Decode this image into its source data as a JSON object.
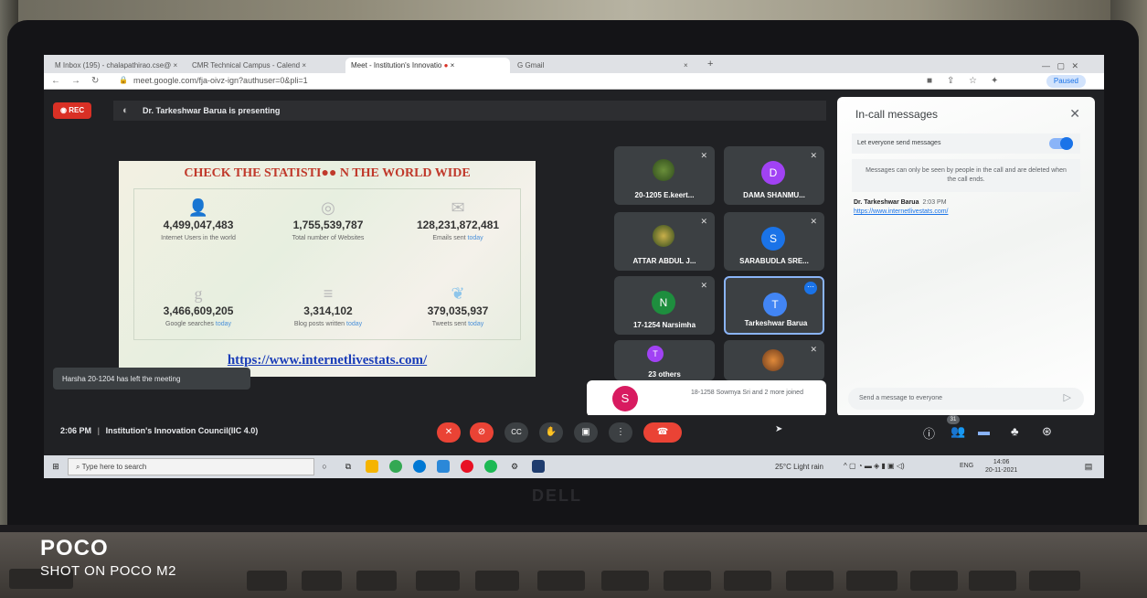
{
  "browser": {
    "tabs": [
      {
        "label": "M  Inbox (195) - chalapathirao.cse@",
        "close": "×"
      },
      {
        "label": "CMR Technical Campus - Calend",
        "close": "×"
      },
      {
        "label": "Meet - Institution's Innovatio",
        "close": "×"
      },
      {
        "label": "G  Gmail",
        "close": "×"
      }
    ],
    "new_tab": "+",
    "url": "meet.google.com/fja-oivz-ign?authuser=0&pli=1",
    "profile_label": "Paused"
  },
  "meet": {
    "rec_label": "REC",
    "presenting_text": "Dr. Tarkeshwar Barua is presenting",
    "slide": {
      "title": "CHECK THE STATISTI●● N THE WORLD WIDE",
      "stats": [
        {
          "icon": "user-icon",
          "glyph": "👤",
          "value": "4,499,047,483",
          "label": "Internet Users in the world",
          "highlight": ""
        },
        {
          "icon": "globe-icon",
          "glyph": "◎",
          "value": "1,755,539,787",
          "label": "Total number of Websites",
          "highlight": ""
        },
        {
          "icon": "mail-icon",
          "glyph": "✉",
          "value": "128,231,872,481",
          "label": "Emails sent",
          "highlight": "today"
        },
        {
          "icon": "google-icon",
          "glyph": "g",
          "value": "3,466,609,205",
          "label": "Google searches",
          "highlight": "today"
        },
        {
          "icon": "rss-icon",
          "glyph": "≡",
          "value": "3,314,102",
          "label": "Blog posts written",
          "highlight": "today"
        },
        {
          "icon": "twitter-icon",
          "glyph": "❦",
          "value": "379,035,937",
          "label": "Tweets sent",
          "highlight": "today"
        }
      ],
      "link": "https://www.internetlivestats.com/"
    },
    "participants": [
      {
        "name": "20-1205 E.keert...",
        "avatar": "",
        "color": ""
      },
      {
        "name": "DAMA SHANMU...",
        "avatar": "D",
        "color": "#a142f4"
      },
      {
        "name": "ATTAR ABDUL J...",
        "avatar": "",
        "color": ""
      },
      {
        "name": "SARABUDLA SRE...",
        "avatar": "S",
        "color": "#1a73e8"
      },
      {
        "name": "17-1254 Narsimha",
        "avatar": "N",
        "color": "#1e8e3e"
      },
      {
        "name": "Tarkeshwar Barua",
        "avatar": "T",
        "color": "#4285f4"
      },
      {
        "name": "23 others",
        "avatar": "T",
        "color": "#a142f4"
      },
      {
        "name": "",
        "avatar": "",
        "color": ""
      }
    ],
    "chat": {
      "title": "In-call messages",
      "toggle_label": "Let everyone send messages",
      "notice": "Messages can only be seen by people in the call and are deleted when the call ends.",
      "author": "Dr. Tarkeshwar Barua",
      "time": "2:03 PM",
      "message": "https://www.internetlivestats.com/",
      "input_placeholder": "Send a message to everyone"
    },
    "toast_left": "Harsha 20-1204 has left the meeting",
    "toast_join": {
      "avatar": "S",
      "text": "18-1258 Sowmya Sri and 2 more joined"
    },
    "bottom": {
      "time": "2:06 PM",
      "separator": "|",
      "meeting_name": "Institution's Innovation Council(IIC 4.0)",
      "people_count": "31"
    }
  },
  "taskbar": {
    "search_placeholder": "Type here to search",
    "weather": "25°C  Light rain",
    "lang": "ENG",
    "time": "14:06",
    "date": "20-11-2021"
  },
  "laptop": {
    "brand": "DELL"
  },
  "watermark": {
    "brand": "POCO",
    "shot": "SHOT ON POCO M2"
  }
}
